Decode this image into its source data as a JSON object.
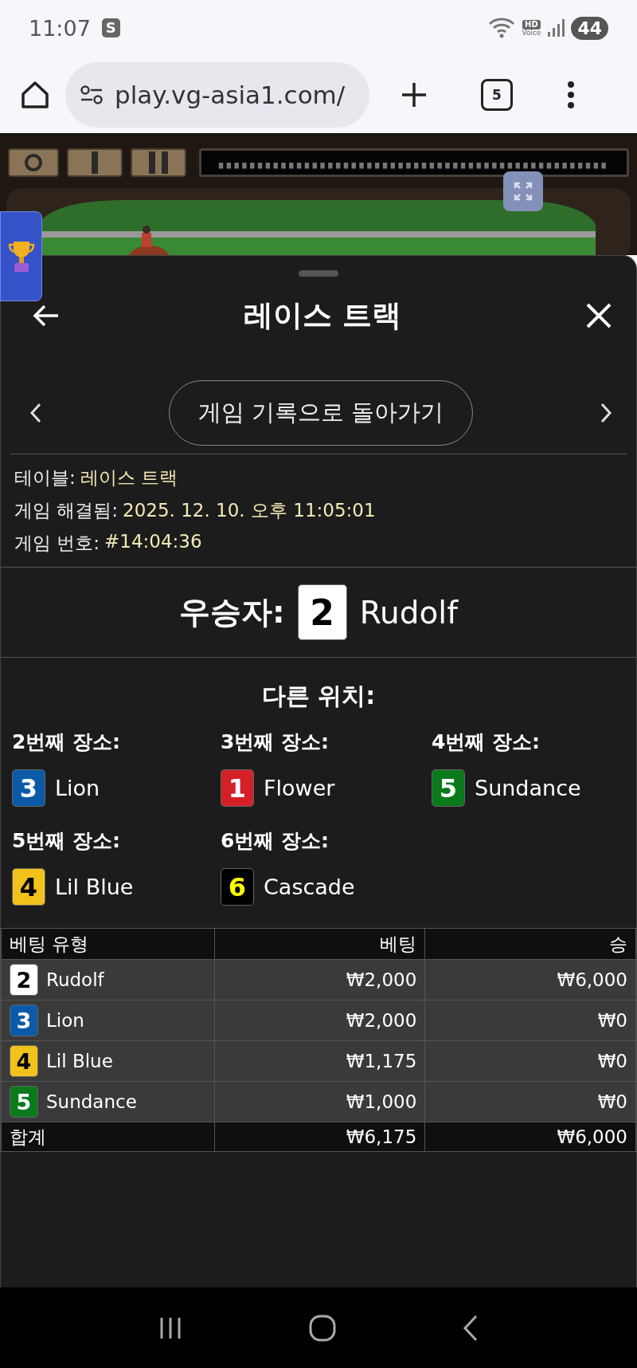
{
  "status_bar": {
    "time": "11:07",
    "app_badge": "S",
    "hd_label": "HD",
    "voice_label": "Voice",
    "battery": "44"
  },
  "browser": {
    "url": "play.vg-asia1.com/",
    "tab_count": "5"
  },
  "sheet": {
    "title": "레이스 트랙",
    "back_to_history": "게임 기록으로 돌아가기",
    "info": [
      {
        "label": "테이블:",
        "value": "레이스 트랙"
      },
      {
        "label": "게임 해결됨:",
        "value": "2025. 12. 10. 오후 11:05:01"
      },
      {
        "label": "게임 번호:",
        "value": "#14:04:36"
      }
    ],
    "winner": {
      "label": "우승자:",
      "number": "2",
      "name": "Rudolf",
      "color": "#ffffff"
    },
    "other_title": "다른 위치:",
    "places": [
      {
        "label": "2번째 장소:",
        "number": "3",
        "name": "Lion",
        "color": "#0b5aa8"
      },
      {
        "label": "3번째 장소:",
        "number": "1",
        "name": "Flower",
        "color": "#d42027"
      },
      {
        "label": "4번째 장소:",
        "number": "5",
        "name": "Sundance",
        "color": "#0a7a1c"
      },
      {
        "label": "5번째 장소:",
        "number": "4",
        "name": "Lil Blue",
        "color": "#f2c21c"
      },
      {
        "label": "6번째 장소:",
        "number": "6",
        "name": "Cascade",
        "color": "#000000"
      }
    ],
    "bets": {
      "columns": [
        "베팅 유형",
        "베팅",
        "승"
      ],
      "rows": [
        {
          "number": "2",
          "name": "Rudolf",
          "color": "#ffffff",
          "bet": "₩2,000",
          "win": "₩6,000"
        },
        {
          "number": "3",
          "name": "Lion",
          "color": "#0b5aa8",
          "bet": "₩2,000",
          "win": "₩0"
        },
        {
          "number": "4",
          "name": "Lil Blue",
          "color": "#f2c21c",
          "bet": "₩1,175",
          "win": "₩0"
        },
        {
          "number": "5",
          "name": "Sundance",
          "color": "#0a7a1c",
          "bet": "₩1,000",
          "win": "₩0"
        }
      ],
      "total": {
        "label": "합계",
        "bet": "₩6,175",
        "win": "₩6,000"
      }
    }
  }
}
